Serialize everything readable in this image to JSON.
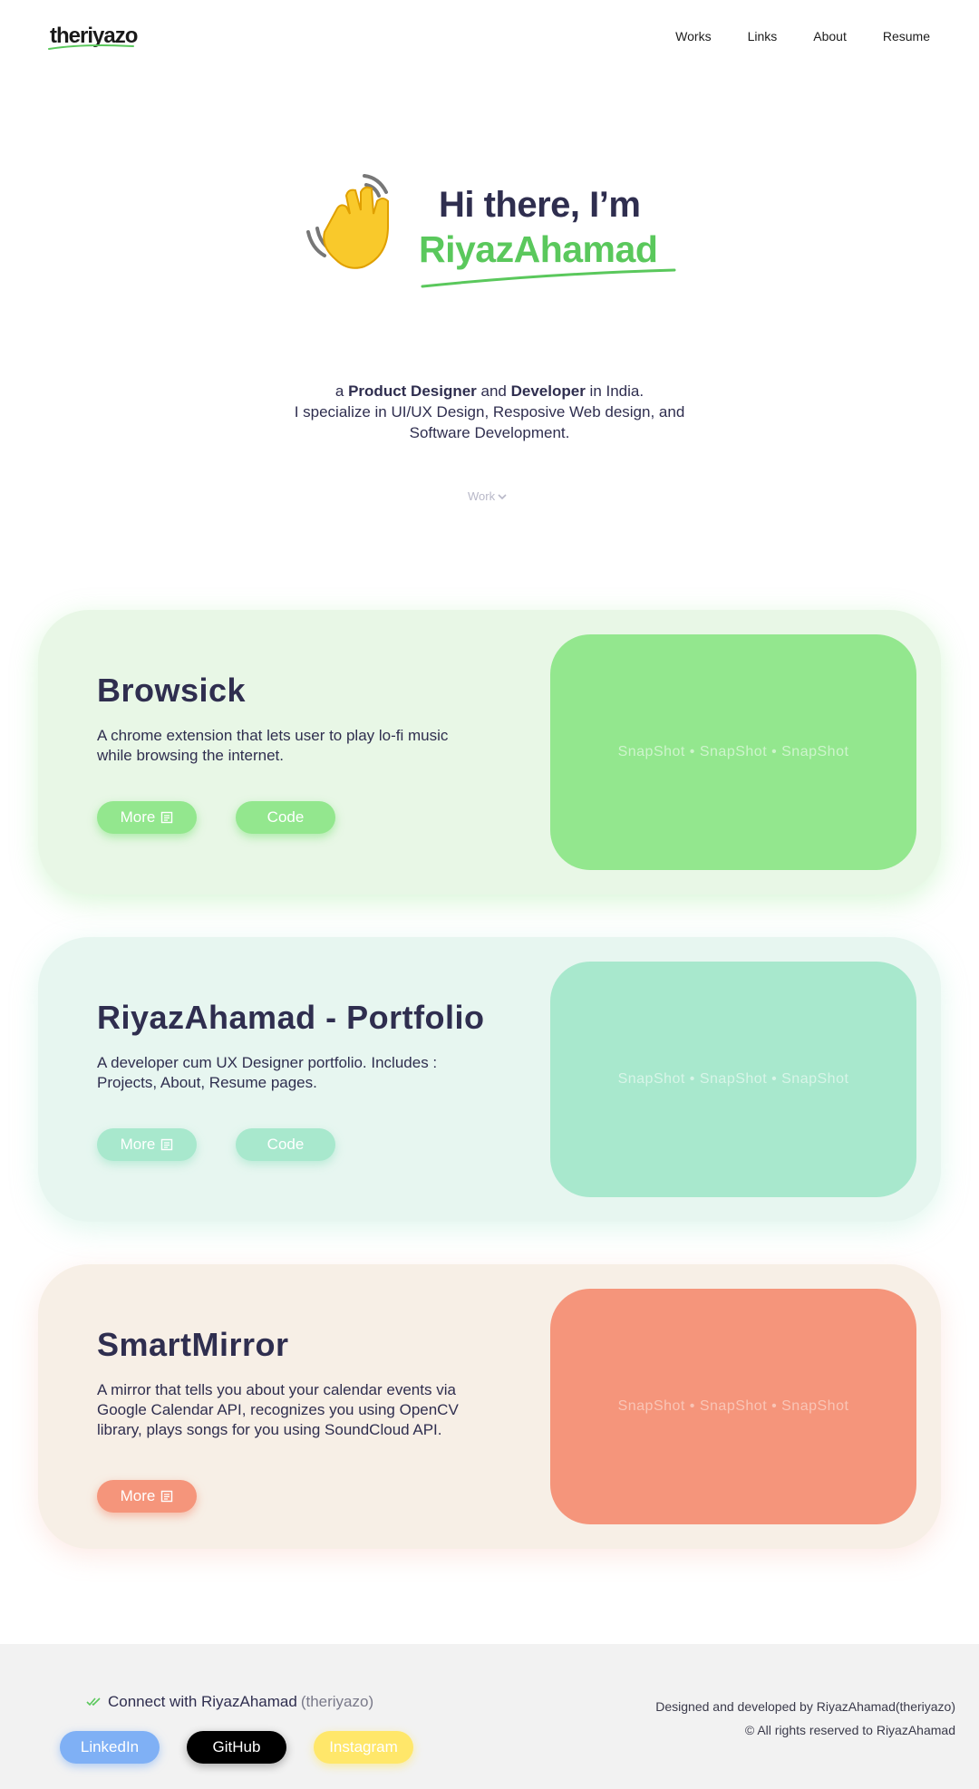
{
  "nav": {
    "logo": "theriyazo",
    "links": [
      "Works",
      "Links",
      "About",
      "Resume"
    ]
  },
  "hero": {
    "greeting": "Hi there, I’m",
    "name": "RiyazAhamad",
    "hand_icon": "waving-hand-icon"
  },
  "intro": {
    "line1_a": "a ",
    "line1_b": "Product Designer",
    "line1_c": " and ",
    "line1_d": "Developer",
    "line1_e": " in India.",
    "line2": "I specialize in UI/UX Design, Resposive Web design, and",
    "line3": "Software Development."
  },
  "work_link": "Work",
  "projects": [
    {
      "title": "Browsick",
      "description": "A chrome extension that lets user to play lo-fi music while browsing the internet.",
      "more_label": "More",
      "code_label": "Code",
      "snapshot": "SnapShot • SnapShot • SnapShot",
      "color": "#93e78e"
    },
    {
      "title": "RiyazAhamad - Portfolio",
      "description": "A developer cum UX Designer portfolio. Includes : Projects, About, Resume pages.",
      "more_label": "More",
      "code_label": "Code",
      "snapshot": "SnapShot • SnapShot • SnapShot",
      "color": "#a8e8cd"
    },
    {
      "title": "SmartMirror",
      "description": "A mirror that tells you about your calendar events via Google Calendar API, recognizes you using OpenCV library, plays songs for you using SoundCloud API.",
      "more_label": "More",
      "snapshot": "SnapShot • SnapShot • SnapShot",
      "color": "#f5957b"
    }
  ],
  "footer": {
    "connect_text": "Connect with RiyazAhamad",
    "connect_handle": "(theriyazo)",
    "social": [
      "LinkedIn",
      "GitHub",
      "Instagram"
    ],
    "credit_line1": "Designed and developed by RiyazAhamad(theriyazo)",
    "credit_line2": "© All rights reserved to RiyazAhamad"
  },
  "colors": {
    "accent_green": "#5ac85c",
    "text_dark": "#2f2e4f",
    "linkedin": "#7fb0f5",
    "github": "#000000",
    "instagram": "#ffe76a"
  }
}
